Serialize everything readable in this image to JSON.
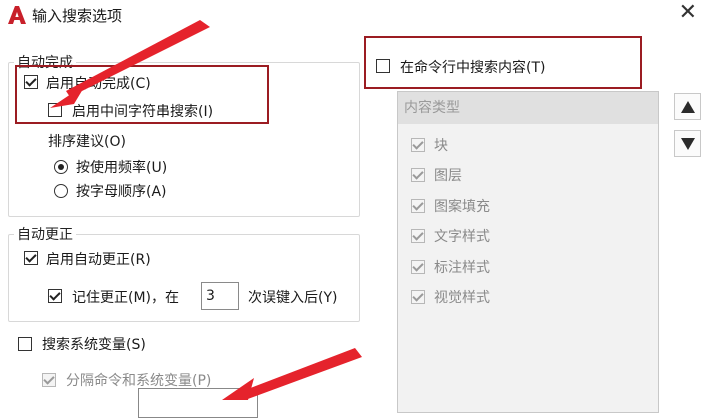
{
  "window": {
    "title": "输入搜索选项",
    "close_label": "✕"
  },
  "autocomplete": {
    "group_title": "自动完成",
    "enable": {
      "label": "启用自动完成(C)",
      "checked": true
    },
    "mid_string": {
      "label": "启用中间字符串搜索(I)",
      "checked": false
    },
    "sort_title": "排序建议(O)",
    "sort_options": [
      {
        "label": "按使用频率(U)",
        "selected": true
      },
      {
        "label": "按字母顺序(A)",
        "selected": false
      }
    ]
  },
  "autocorrect": {
    "group_title": "自动更正",
    "enable": {
      "label": "启用自动更正(R)",
      "checked": true
    },
    "remember": {
      "label_before": "记住更正(M)，在",
      "value": "3",
      "label_after": "次误键入后(Y)",
      "checked": true
    }
  },
  "system_vars": {
    "search": {
      "label": "搜索系统变量(S)",
      "checked": false
    },
    "separate": {
      "label": "分隔命令和系统变量(P)",
      "checked": true
    }
  },
  "cmdline": {
    "search_content": {
      "label": "在命令行中搜索内容(T)",
      "checked": false
    }
  },
  "content_types": {
    "header": "内容类型",
    "items": [
      {
        "label": "块",
        "checked": true
      },
      {
        "label": "图层",
        "checked": true
      },
      {
        "label": "图案填充",
        "checked": true
      },
      {
        "label": "文字样式",
        "checked": true
      },
      {
        "label": "标注样式",
        "checked": true
      },
      {
        "label": "视觉样式",
        "checked": true
      }
    ]
  },
  "buttons": {
    "move_up_icon": "triangle-up-icon",
    "move_down_icon": "triangle-down-icon"
  },
  "colors": {
    "annotation_red": "#9b1c22",
    "arrow_red": "#e5232c",
    "app_icon_red": "#c8202a"
  }
}
